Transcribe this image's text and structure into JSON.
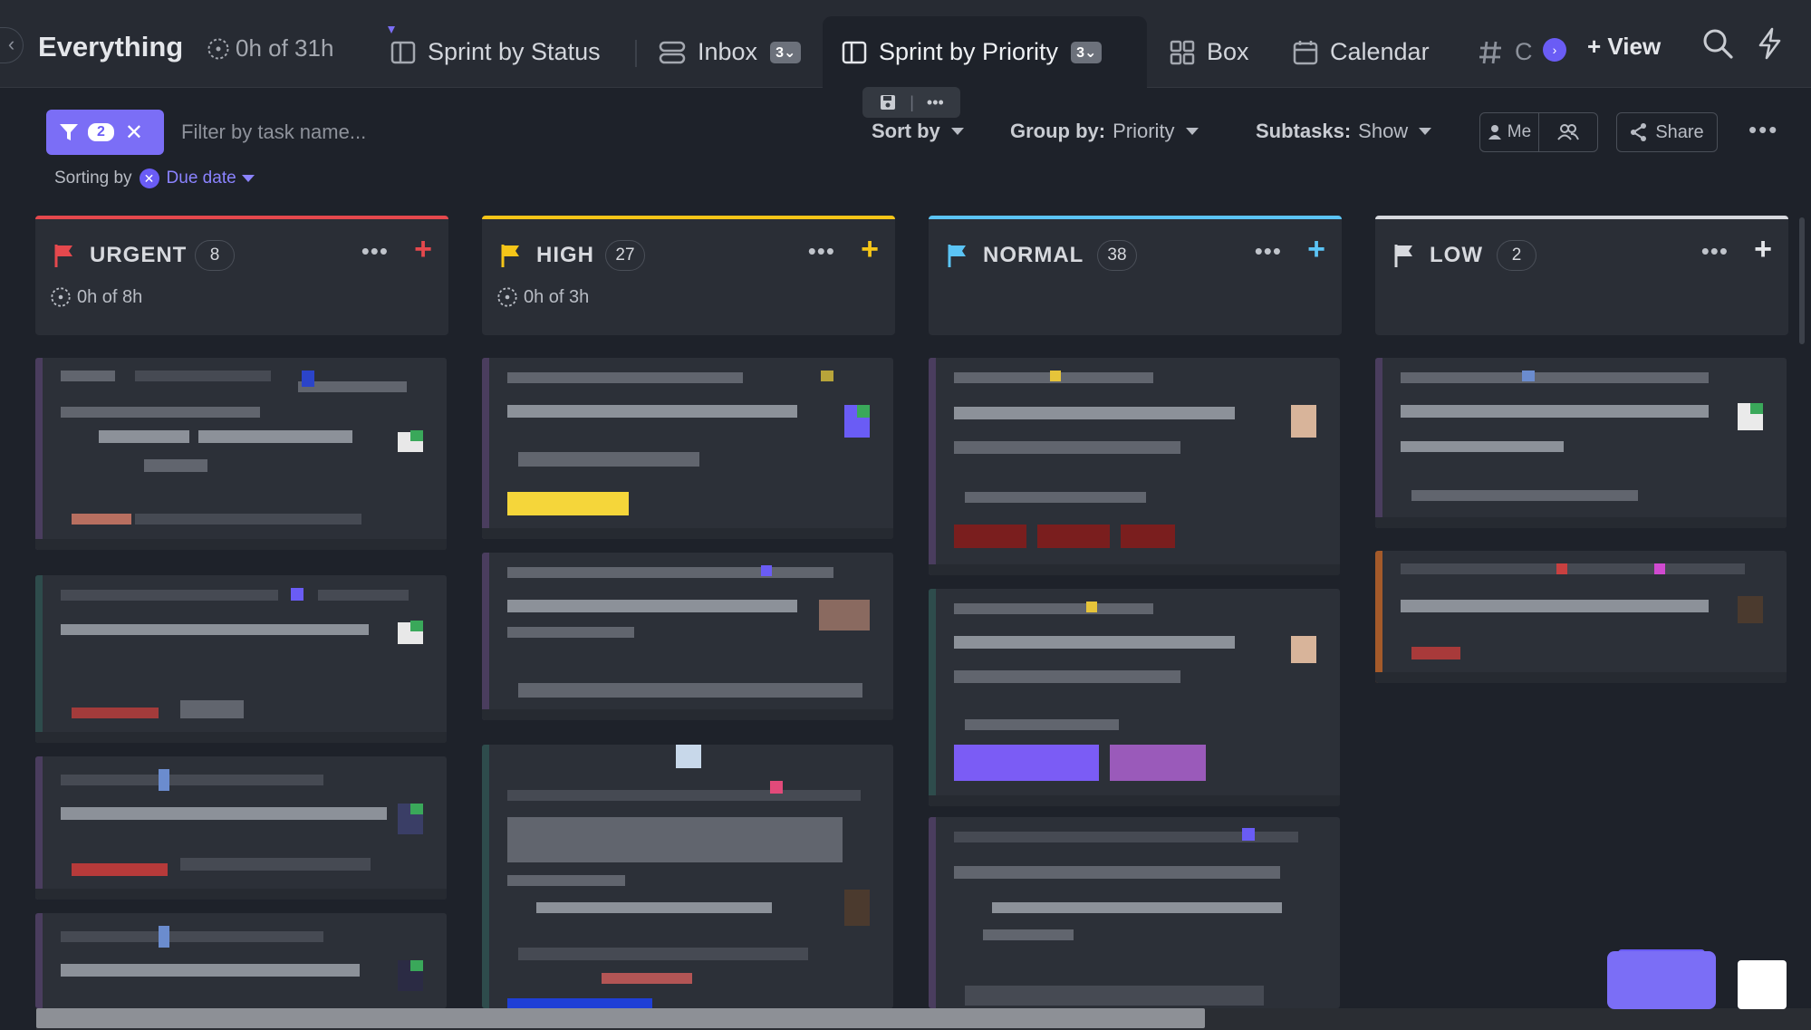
{
  "header": {
    "title": "Everything",
    "time": "0h of 31h",
    "tabs": [
      {
        "label": "Sprint by Status",
        "icon": "board-icon"
      },
      {
        "label": "Inbox",
        "badge": "3",
        "icon": "inbox-icon"
      },
      {
        "label": "Sprint by Priority",
        "badge": "3",
        "icon": "board-icon",
        "active": true
      },
      {
        "label": "Box",
        "icon": "grid-icon"
      },
      {
        "label": "Calendar",
        "icon": "calendar-icon"
      },
      {
        "label": "C",
        "icon": "hash-icon"
      }
    ],
    "add_view": "View",
    "view_toolbar_sep": "|"
  },
  "filters": {
    "count": "2",
    "placeholder": "Filter by task name...",
    "sort_by": "Sort by",
    "group_by_key": "Group by:",
    "group_by_value": "Priority",
    "subtasks_key": "Subtasks:",
    "subtasks_value": "Show",
    "me": "Me",
    "share": "Share",
    "sorting_label": "Sorting by",
    "sorting_value": "Due date"
  },
  "columns": [
    {
      "name": "URGENT",
      "count": "8",
      "time": "0h of 8h",
      "color": "#e5484d"
    },
    {
      "name": "HIGH",
      "count": "27",
      "time": "0h of 3h",
      "color": "#f5c518"
    },
    {
      "name": "NORMAL",
      "count": "38",
      "time": "",
      "color": "#5bc4f5"
    },
    {
      "name": "LOW",
      "count": "2",
      "time": "",
      "color": "#d7d9de"
    }
  ],
  "colors": {
    "accent": "#7b6ef6",
    "background": "#1e222a",
    "header": "#272b33",
    "card": "#2c3038"
  }
}
